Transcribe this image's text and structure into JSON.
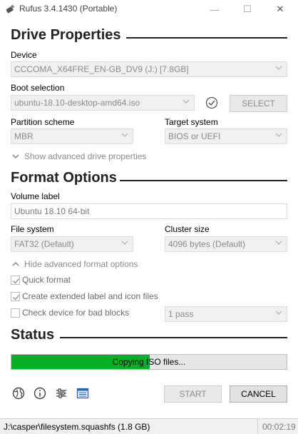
{
  "window": {
    "title": "Rufus 3.4.1430 (Portable)",
    "minimize": "—",
    "maximize": "☐",
    "close": "✕"
  },
  "drive_properties": {
    "heading": "Drive Properties",
    "device_label": "Device",
    "device_value": "CCCOMA_X64FRE_EN-GB_DV9 (J:) [7.8GB]",
    "boot_label": "Boot selection",
    "boot_value": "ubuntu-18.10-desktop-amd64.iso",
    "select_button": "SELECT",
    "partition_label": "Partition scheme",
    "partition_value": "MBR",
    "target_label": "Target system",
    "target_value": "BIOS or UEFI",
    "advanced_toggle": "Show advanced drive properties"
  },
  "format_options": {
    "heading": "Format Options",
    "volume_label": "Volume label",
    "volume_value": "Ubuntu 18.10 64-bit",
    "fs_label": "File system",
    "fs_value": "FAT32 (Default)",
    "cluster_label": "Cluster size",
    "cluster_value": "4096 bytes (Default)",
    "advanced_toggle": "Hide advanced format options",
    "quick_format": {
      "label": "Quick format",
      "checked": true
    },
    "extended_label": {
      "label": "Create extended label and icon files",
      "checked": true
    },
    "bad_blocks": {
      "label": "Check device for bad blocks",
      "checked": false
    },
    "passes_value": "1 pass"
  },
  "status": {
    "heading": "Status",
    "progress_text": "Copying ISO files...",
    "progress_fraction": 0.503,
    "progress_color": "#06b025"
  },
  "toolbar": {
    "icons": [
      "globe-icon",
      "info-icon",
      "settings-sliders-icon",
      "log-icon"
    ],
    "start_button": "START",
    "cancel_button": "CANCEL"
  },
  "statusbar": {
    "path": "J:\\casper\\filesystem.squashfs (1.8 GB)",
    "elapsed": "00:02:19"
  }
}
